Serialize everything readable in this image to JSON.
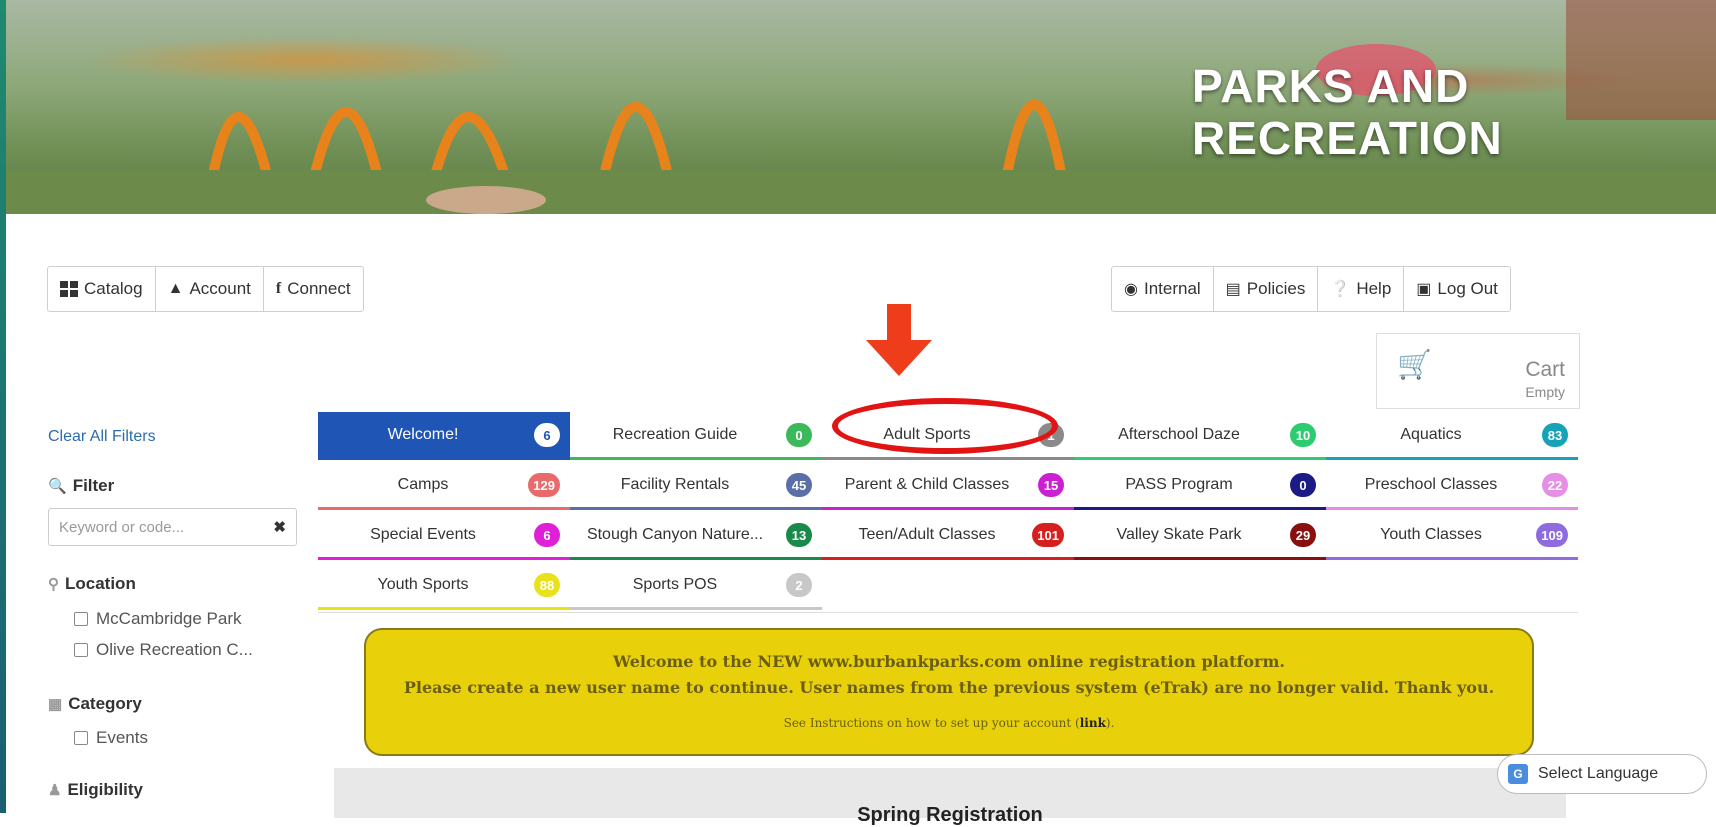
{
  "header": {
    "title_line1": "PARKS AND",
    "title_line2": "RECREATION"
  },
  "nav_left": [
    {
      "label": "Catalog",
      "icon": "grid-icon"
    },
    {
      "label": "Account",
      "icon": "user-icon"
    },
    {
      "label": "Connect",
      "icon": "facebook-icon"
    }
  ],
  "nav_right": [
    {
      "label": "Internal",
      "icon": "shield-icon"
    },
    {
      "label": "Policies",
      "icon": "document-icon"
    },
    {
      "label": "Help",
      "icon": "question-icon"
    },
    {
      "label": "Log Out",
      "icon": "lock-icon"
    }
  ],
  "cart": {
    "label": "Cart",
    "status": "Empty"
  },
  "sidebar": {
    "clear_filters": "Clear All Filters",
    "filter_heading": "Filter",
    "keyword_placeholder": "Keyword or code...",
    "location_heading": "Location",
    "locations": [
      "McCambridge Park",
      "Olive Recreation C..."
    ],
    "category_heading": "Category",
    "categories": [
      "Events"
    ],
    "eligibility_heading": "Eligibility"
  },
  "tabs": [
    {
      "label": "Welcome!",
      "count": "6",
      "color": "#1f56b5"
    },
    {
      "label": "Recreation Guide",
      "count": "0",
      "color": "#3cb95a"
    },
    {
      "label": "Adult Sports",
      "count": "1",
      "color": "#8a8a8a"
    },
    {
      "label": "Afterschool Daze",
      "count": "10",
      "color": "#2ecc71"
    },
    {
      "label": "Aquatics",
      "count": "83",
      "color": "#17a2b8"
    },
    {
      "label": "Camps",
      "count": "129",
      "color": "#e86a6a"
    },
    {
      "label": "Facility Rentals",
      "count": "45",
      "color": "#5a6ea8"
    },
    {
      "label": "Parent & Child Classes",
      "count": "15",
      "color": "#cc1fd1"
    },
    {
      "label": "PASS Program",
      "count": "0",
      "color": "#1c1a86"
    },
    {
      "label": "Preschool Classes",
      "count": "22",
      "color": "#e58ee6"
    },
    {
      "label": "Special Events",
      "count": "6",
      "color": "#e01fd8"
    },
    {
      "label": "Stough Canyon Nature...",
      "count": "13",
      "color": "#198a4a"
    },
    {
      "label": "Teen/Adult Classes",
      "count": "101",
      "color": "#d61f1f"
    },
    {
      "label": "Valley Skate Park",
      "count": "29",
      "color": "#8a0f0f"
    },
    {
      "label": "Youth Classes",
      "count": "109",
      "color": "#8e6ce0"
    },
    {
      "label": "Youth Sports",
      "count": "88",
      "color": "#e9e21a"
    },
    {
      "label": "Sports POS",
      "count": "2",
      "color": "#c8c8c8"
    }
  ],
  "notice": {
    "line1": "Welcome to the NEW www.burbankparks.com online registration platform.",
    "line2": "Please create a new user name to continue. User names from the previous system (eTrak) are no longer valid. Thank you.",
    "line3_pre": "See Instructions on how to set up your account (",
    "line3_link": "link",
    "line3_post": ")."
  },
  "section_heading": "Spring Registration",
  "language_button": "Select Language"
}
